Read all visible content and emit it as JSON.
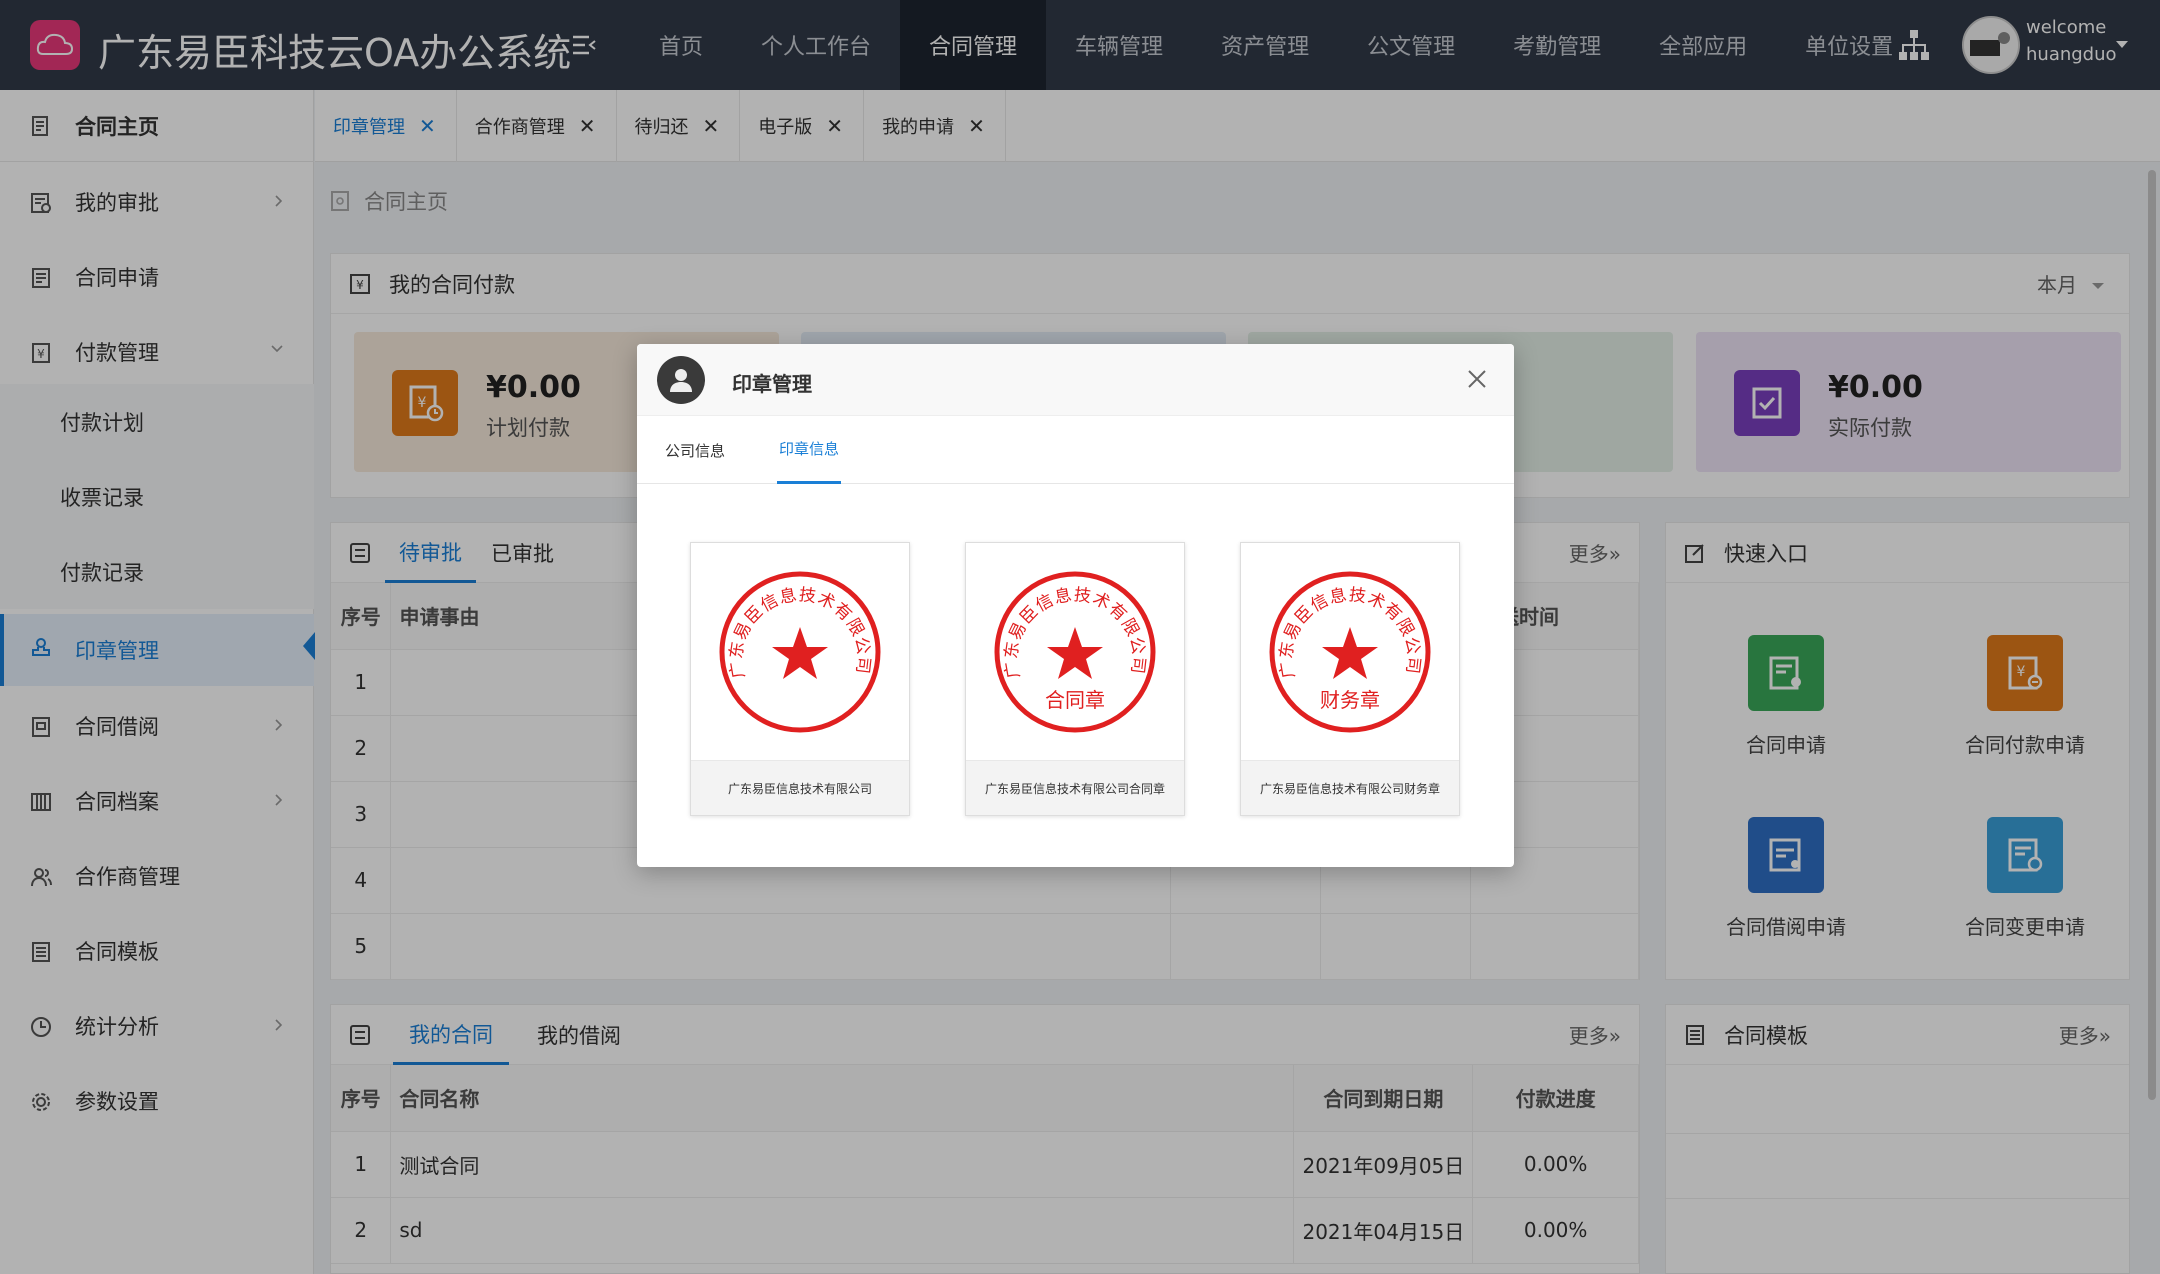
{
  "app": {
    "title": "广东易臣科技云OA办公系统"
  },
  "nav": [
    "首页",
    "个人工作台",
    "合同管理",
    "车辆管理",
    "资产管理",
    "公文管理",
    "考勤管理",
    "全部应用",
    "单位设置"
  ],
  "nav_active_index": 2,
  "user": {
    "greeting": "welcome",
    "name": "huangduo"
  },
  "sidebar": {
    "home": "合同主页",
    "items": [
      {
        "label": "我的审批"
      },
      {
        "label": "合同申请"
      },
      {
        "label": "付款管理"
      },
      {
        "label": "付款计划"
      },
      {
        "label": "收票记录"
      },
      {
        "label": "付款记录"
      },
      {
        "label": "印章管理"
      },
      {
        "label": "合同借阅"
      },
      {
        "label": "合同档案"
      },
      {
        "label": "合作商管理"
      },
      {
        "label": "合同模板"
      },
      {
        "label": "统计分析"
      },
      {
        "label": "参数设置"
      }
    ]
  },
  "tabs": [
    "印章管理",
    "合作商管理",
    "待归还",
    "电子版",
    "我的申请"
  ],
  "breadcrumb": "合同主页",
  "payments": {
    "title": "我的合同付款",
    "period": "本月",
    "planned": {
      "value": "¥0.00",
      "label": "计划付款"
    },
    "actual": {
      "value": "¥0.00",
      "label": "实际付款"
    }
  },
  "approvals": {
    "tab_pending": "待审批",
    "tab_done": "已审批",
    "more": "更多»",
    "col_no": "序号",
    "col_reason": "申请事由",
    "col_time": "发送时间",
    "rows": [
      "1",
      "2",
      "3",
      "4",
      "5"
    ]
  },
  "quick": {
    "title": "快速入口",
    "items": [
      "合同申请",
      "合同付款申请",
      "合同借阅申请",
      "合同变更申请"
    ]
  },
  "contracts": {
    "tab_mine": "我的合同",
    "tab_borrow": "我的借阅",
    "more": "更多»",
    "col_no": "序号",
    "col_name": "合同名称",
    "col_due": "合同到期日期",
    "col_progress": "付款进度",
    "rows": [
      {
        "no": "1",
        "name": "测试合同",
        "due": "2021年09月05日",
        "progress": "0.00%"
      },
      {
        "no": "2",
        "name": "sd",
        "due": "2021年04月15日",
        "progress": "0.00%"
      }
    ]
  },
  "templates": {
    "title": "合同模板",
    "more": "更多»"
  },
  "modal": {
    "title": "印章管理",
    "tab_company": "公司信息",
    "tab_seal": "印章信息",
    "seals": [
      {
        "caption": "广东易臣信息技术有限公司",
        "ring_text": "广东易臣信息技术有限公司",
        "sub": ""
      },
      {
        "caption": "广东易臣信息技术有限公司合同章",
        "ring_text": "广东易臣信息技术有限公司",
        "sub": "合同章"
      },
      {
        "caption": "广东易臣信息技术有限公司财务章",
        "ring_text": "广东易臣信息技术有限公司",
        "sub": "财务章"
      }
    ]
  },
  "colors": {
    "accent": "#1a7fd6",
    "topbar": "#323a48",
    "seal_red": "#e02020",
    "logo": "#e8397a"
  }
}
